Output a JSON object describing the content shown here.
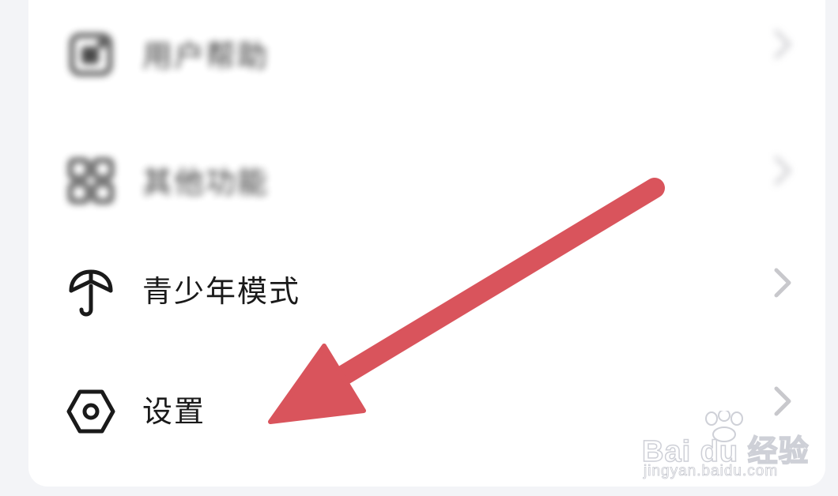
{
  "menu": {
    "items": [
      {
        "label": "用户帮助",
        "icon": "help-icon",
        "blurred": true
      },
      {
        "label": "其他功能",
        "icon": "grid-icon",
        "blurred": true
      },
      {
        "label": "青少年模式",
        "icon": "umbrella-icon",
        "blurred": false
      },
      {
        "label": "设置",
        "icon": "settings-hexagon-icon",
        "blurred": false
      }
    ]
  },
  "annotation": {
    "arrow_color": "#d9545c",
    "points_to": "设置"
  },
  "watermark": {
    "brand": "Bai du 经验",
    "site": "jingyan.baidu.com"
  },
  "colors": {
    "background": "#f3f4f7",
    "card": "#ffffff",
    "text": "#1a1a1a",
    "chevron": "#c8c8cc"
  }
}
